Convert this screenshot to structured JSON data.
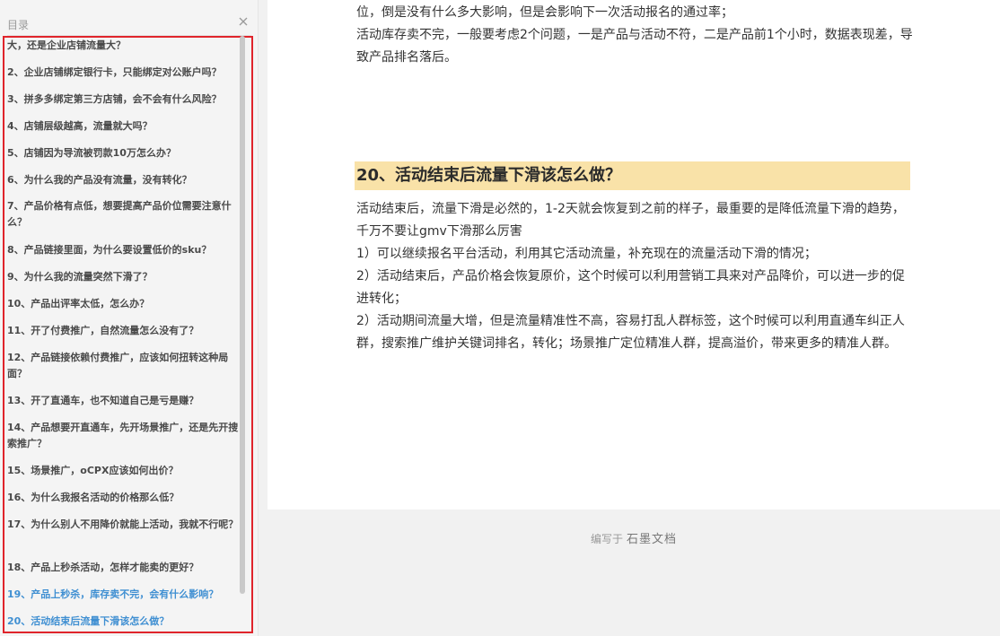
{
  "toc": {
    "title": "目录",
    "items": [
      "大，还是企业店铺流量大？",
      "2、企业店铺绑定银行卡，只能绑定对公账户吗？",
      "3、拼多多绑定第三方店铺，会不会有什么风险？",
      "4、店铺层级越高，流量就大吗？",
      "5、店铺因为导流被罚款10万怎么办？",
      "6、为什么我的产品没有流量，没有转化？",
      "7、产品价格有点低，想要提高产品价位需要注意什么？",
      "8、产品链接里面，为什么要设置低价的sku？",
      "9、为什么我的流量突然下滑了？",
      "10、产品出评率太低，怎么办？",
      "11、开了付费推广，自然流量怎么没有了？",
      "12、产品链接依赖付费推广，应该如何扭转这种局面？",
      "13、开了直通车，也不知道自己是亏是赚？",
      "14、产品想要开直通车，先开场景推广，还是先开搜索推广？",
      "15、场景推广，oCPX应该如何出价？",
      "16、为什么我报名活动的价格那么低？",
      "17、为什么别人不用降价就能上活动，我就不行呢？",
      "18、产品上秒杀活动，怎样才能卖的更好？",
      "19、产品上秒杀，库存卖不完，会有什么影响？",
      "20、活动结束后流量下滑该怎么做？"
    ],
    "active_indices": [
      18,
      19
    ]
  },
  "doc": {
    "top_paragraphs": [
      "位，倒是没有什么多大影响，但是会影响下一次活动报名的通过率；",
      "活动库存卖不完，一般要考虑2个问题，一是产品与活动不符，二是产品前1个小时，数据表现差，导致产品排名落后。"
    ],
    "heading": "20、活动结束后流量下滑该怎么做？",
    "body_paragraphs": [
      "活动结束后，流量下滑是必然的，1-2天就会恢复到之前的样子，最重要的是降低流量下滑的趋势，千万不要让gmv下滑那么厉害",
      "1）可以继续报名平台活动，利用其它活动流量，补充现在的流量活动下滑的情况；",
      "2）活动结束后，产品价格会恢复原价，这个时候可以利用营销工具来对产品降价，可以进一步的促进转化；",
      "2）活动期间流量大增，但是流量精准性不高，容易打乱人群标签，这个时候可以利用直通车纠正人群，搜索推广维护关键词排名，转化；场景推广定位精准人群，提高溢价，带来更多的精准人群。"
    ]
  },
  "footer": {
    "prefix": "编写于",
    "brand": "石墨文档"
  },
  "colors": {
    "highlight": "#f9e2a8",
    "active_link": "#3f8fd2",
    "red_frame": "#e0242b"
  }
}
